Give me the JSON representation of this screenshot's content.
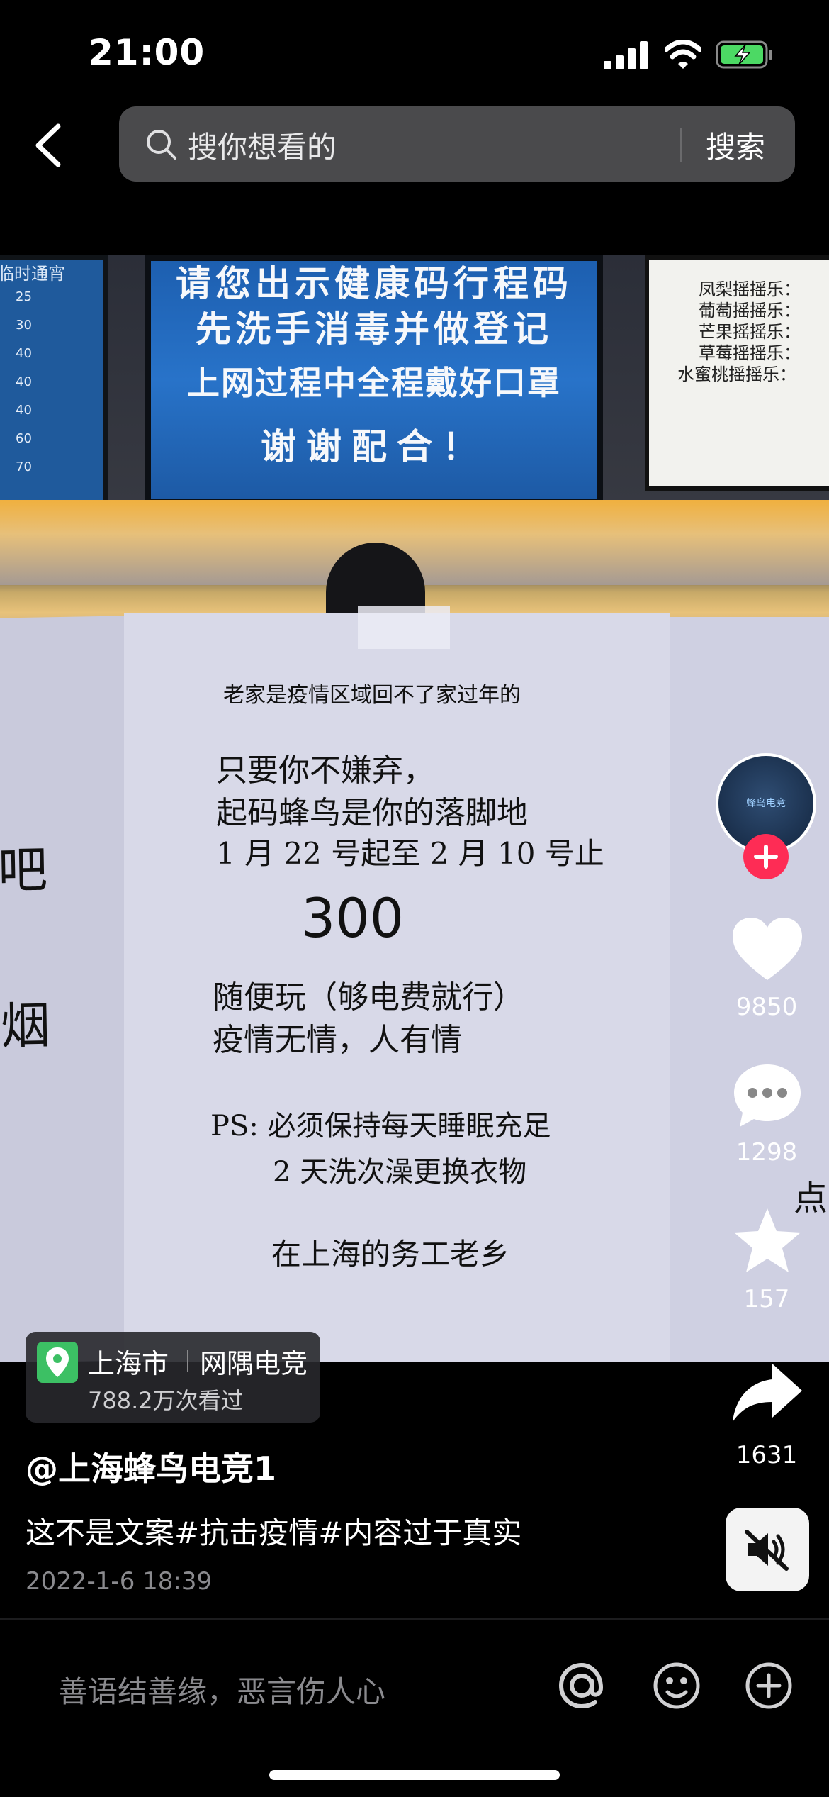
{
  "status_bar": {
    "time": "21:00"
  },
  "search": {
    "placeholder": "搜你想看的",
    "button": "搜索"
  },
  "video": {
    "screen_left": {
      "label": "临时通宵",
      "values": [
        "25",
        "30",
        "40",
        "40",
        "40",
        "60",
        "70"
      ]
    },
    "screen_center": {
      "lines": [
        "请您出示健康码行程码",
        "先洗手消毒并做登记",
        "上网过程中全程戴好口罩",
        "谢谢配合！"
      ]
    },
    "screen_right": {
      "lines": [
        "凤梨摇摇乐：",
        "葡萄摇摇乐：",
        "芒果摇摇乐：",
        "草莓摇摇乐：",
        "水蜜桃摇摇乐："
      ]
    },
    "paper": {
      "header": "老家是疫情区域回不了家过年的",
      "lines": [
        "只要你不嫌弃，",
        "起码蜂鸟是你的落脚地",
        "1 月 22 号起至 2 月 10 号止"
      ],
      "price": "300",
      "lines2": [
        "随便玩（够电费就行）",
        "疫情无情，人有情"
      ],
      "ps": [
        "PS: 必须保持每天睡眠充足",
        "2 天洗次澡更换衣物"
      ],
      "signature": "在上海的务工老乡",
      "left_chars": [
        "吧",
        "烟"
      ],
      "right_char": "点"
    }
  },
  "sidebar": {
    "avatar_text": "蜂鸟电竞",
    "likes": "9850",
    "comments": "1298",
    "favorites": "157",
    "shares": "1631"
  },
  "location": {
    "city": "上海市",
    "place": "网隅电竞",
    "views": "788.2万次看过"
  },
  "post": {
    "author": "@上海蜂鸟电竞1",
    "caption": "这不是文案#抗击疫情#内容过于真实",
    "datetime": "2022-1-6 18:39"
  },
  "comment_bar": {
    "placeholder": "善语结善缘，恶言伤人心"
  },
  "colors": {
    "follow": "#fe2c55",
    "location_icon": "#3cc064",
    "battery": "#4cd964"
  }
}
